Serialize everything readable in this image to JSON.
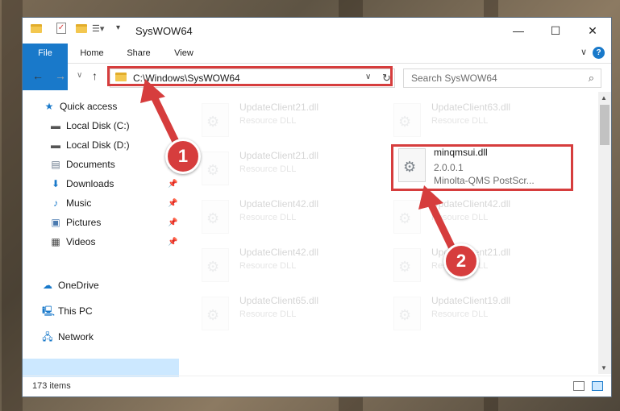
{
  "window": {
    "title": "SysWOW64",
    "minimize_glyph": "—",
    "maximize_glyph": "☐",
    "close_glyph": "✕"
  },
  "ribbon": {
    "tabs": [
      "File",
      "Home",
      "Share",
      "View"
    ],
    "help_glyph": "?",
    "collapse_glyph": "∨"
  },
  "address": {
    "path": "C:\\Windows\\SysWOW64",
    "dropdown_glyph": "∨",
    "refresh_glyph": "↻"
  },
  "nav_buttons": {
    "back": "←",
    "forward": "→",
    "recent": "∨",
    "up": "↑"
  },
  "search": {
    "placeholder": "Search SysWOW64",
    "icon_glyph": "⌕"
  },
  "nav_pane": {
    "quick_access": "Quick access",
    "items": [
      {
        "label": "Local Disk (C:)",
        "icon": "drive-icon"
      },
      {
        "label": "Local Disk (D:)",
        "icon": "drive-icon"
      },
      {
        "label": "Documents",
        "icon": "documents-icon"
      },
      {
        "label": "Downloads",
        "icon": "downloads-icon"
      },
      {
        "label": "Music",
        "icon": "music-icon"
      },
      {
        "label": "Pictures",
        "icon": "pictures-icon"
      },
      {
        "label": "Videos",
        "icon": "videos-icon"
      }
    ],
    "onedrive": "OneDrive",
    "this_pc": "This PC",
    "network": "Network",
    "pin_glyph": "📌"
  },
  "files": {
    "left": [
      {
        "name": "UpdateClient21.dll",
        "desc": "Resource DLL"
      },
      {
        "name": "UpdateClient21.dll",
        "desc": "Resource DLL"
      },
      {
        "name": "UpdateClient42.dll",
        "desc": "Resource DLL"
      },
      {
        "name": "UpdateClient42.dll",
        "desc": "Resource DLL"
      },
      {
        "name": "UpdateClient65.dll",
        "desc": "Resource DLL"
      }
    ],
    "right": [
      {
        "name": "UpdateClient63.dll",
        "desc": "Resource DLL"
      },
      {
        "name": "UpdateClient42.dll",
        "desc": "Resource DLL"
      },
      {
        "name": "UpdateClient21.dll",
        "desc": "Resource DLL"
      },
      {
        "name": "UpdateClient19.dll",
        "desc": "Resource DLL"
      }
    ],
    "highlighted": {
      "name": "minqmsui.dll",
      "version": "2.0.0.1",
      "desc": "Minolta-QMS PostScr..."
    }
  },
  "status": {
    "item_count": "173 items"
  },
  "callouts": {
    "one": "1",
    "two": "2"
  },
  "colors": {
    "accent": "#1979ca",
    "highlight": "#d63d3d",
    "selection": "#cce8ff"
  }
}
